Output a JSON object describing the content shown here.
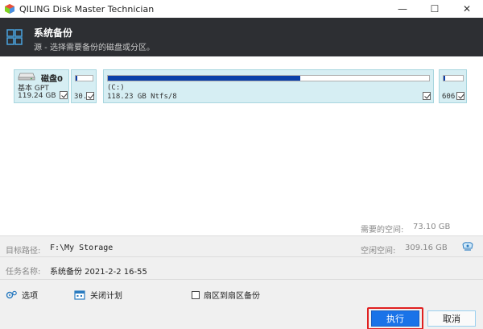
{
  "window": {
    "title": "QILING Disk Master Technician",
    "minimize": "—",
    "maximize": "☐",
    "close": "✕"
  },
  "header": {
    "title": "系统备份",
    "subtitle": "源 - 选择需要备份的磁盘或分区。"
  },
  "disk": {
    "name": "磁盘0",
    "type": "基本 GPT",
    "size": "119.24 GB",
    "checked": true
  },
  "partitions": [
    {
      "label": "30.",
      "checked": true,
      "used_fraction": 0.1
    },
    {
      "drive": "(C:)",
      "label": "118.23 GB Ntfs/8",
      "checked": true,
      "used_fraction": 0.6
    },
    {
      "label": "606",
      "checked": true,
      "used_fraction": 0.1
    }
  ],
  "space": {
    "required_label": "需要的空间:",
    "required_value": "73.10 GB",
    "free_label": "空闲空间:",
    "free_value": "309.16 GB"
  },
  "fields": {
    "target_label": "目标路径:",
    "target_value": "F:\\My Storage",
    "task_label": "任务名称:",
    "task_value": "系统备份 2021-2-2 16-55"
  },
  "options": {
    "settings": "选项",
    "schedule": "关闭计划",
    "sector": "扇区到扇区备份"
  },
  "buttons": {
    "execute": "执行",
    "cancel": "取消"
  },
  "colors": {
    "header_bg": "#2d2f33",
    "partition_bg": "#d6eef3",
    "usage_fill": "#0b3fa8",
    "execute_bg": "#1a73e8",
    "highlight": "#e02020"
  }
}
